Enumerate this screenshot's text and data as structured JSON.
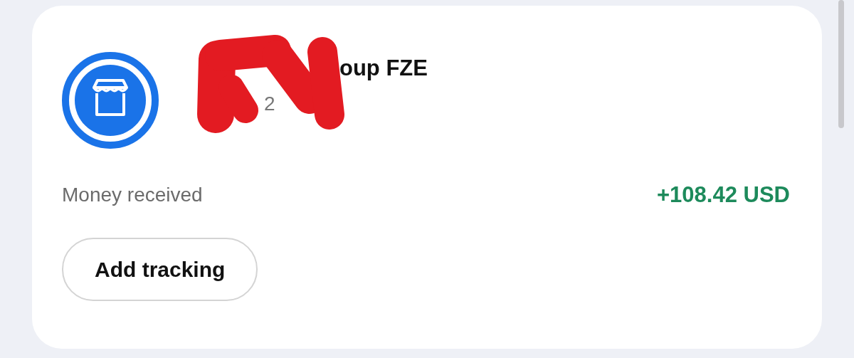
{
  "transaction": {
    "merchant_name": "oup FZE",
    "subtitle": "2",
    "redacted": true,
    "description": "Money received",
    "amount": "+108.42 USD"
  },
  "buttons": [
    {
      "label": "Add tracking"
    }
  ]
}
